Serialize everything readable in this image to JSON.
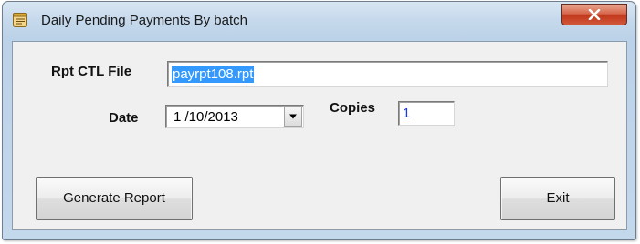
{
  "window": {
    "title": "Daily Pending Payments By batch",
    "accent": "#c3391c"
  },
  "form": {
    "rpt_ctl_label": "Rpt CTL File",
    "rpt_ctl_value": "payrpt108.rpt",
    "date_label": "Date",
    "date_value": "1 /10/2013",
    "copies_label": "Copies",
    "copies_value": "1",
    "selection_color": "#3399ff"
  },
  "buttons": {
    "generate_label": "Generate Report",
    "exit_label": "Exit"
  },
  "icons": {
    "app": "report-list-icon",
    "close": "close-icon",
    "dropdown": "chevron-down-icon"
  }
}
